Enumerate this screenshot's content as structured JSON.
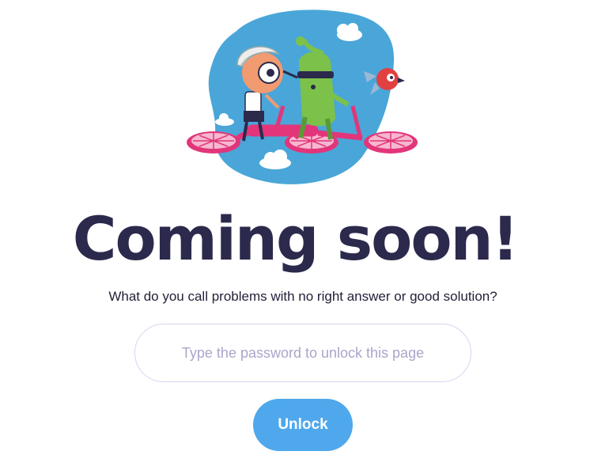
{
  "heading": "Coming soon!",
  "question": "What do you call problems with no right answer or good solution?",
  "password": {
    "placeholder": "Type the password to unlock this page",
    "value": ""
  },
  "unlock_label": "Unlock",
  "colors": {
    "title": "#2b2a4c",
    "button": "#4fa8ec",
    "input_border": "#d6d3f0",
    "placeholder": "#a9a6c9",
    "blob": "#4aa6d8",
    "bike": "#e2357a"
  },
  "illustration": "characters-riding-tandem-bike"
}
